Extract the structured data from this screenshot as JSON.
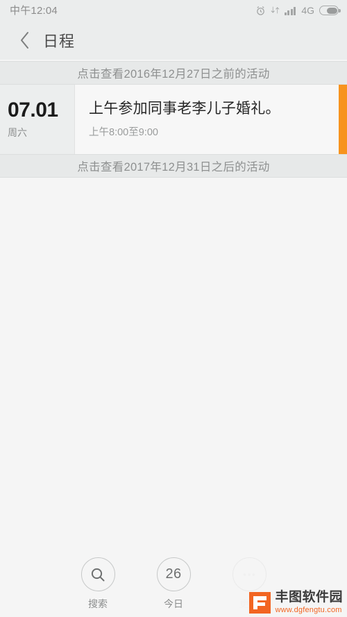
{
  "status_bar": {
    "clock": "中午12:04",
    "network_label": "4G",
    "icons": [
      "alarm-clock-icon",
      "data-transfer-icon",
      "signal-bars-icon",
      "battery-icon"
    ]
  },
  "title_bar": {
    "back_icon": "chevron-left-icon",
    "title": "日程"
  },
  "banners": {
    "before": "点击查看2016年12月27日之前的活动",
    "after": "点击查看2017年12月31日之后的活动"
  },
  "event": {
    "date": "07.01",
    "weekday": "周六",
    "title": "上午参加同事老李儿子婚礼。",
    "time": "上午8:00至9:00",
    "accent_color": "#f7931e"
  },
  "bottom_nav": {
    "items": [
      {
        "label": "搜索",
        "icon": "search-icon",
        "value": ""
      },
      {
        "label": "今日",
        "icon": "today-icon",
        "value": "26"
      },
      {
        "label": "更多",
        "icon": "more-icon",
        "value": ""
      }
    ]
  },
  "watermark": {
    "name": "丰图软件园",
    "url": "www.dgfengtu.com",
    "color": "#f26522"
  }
}
